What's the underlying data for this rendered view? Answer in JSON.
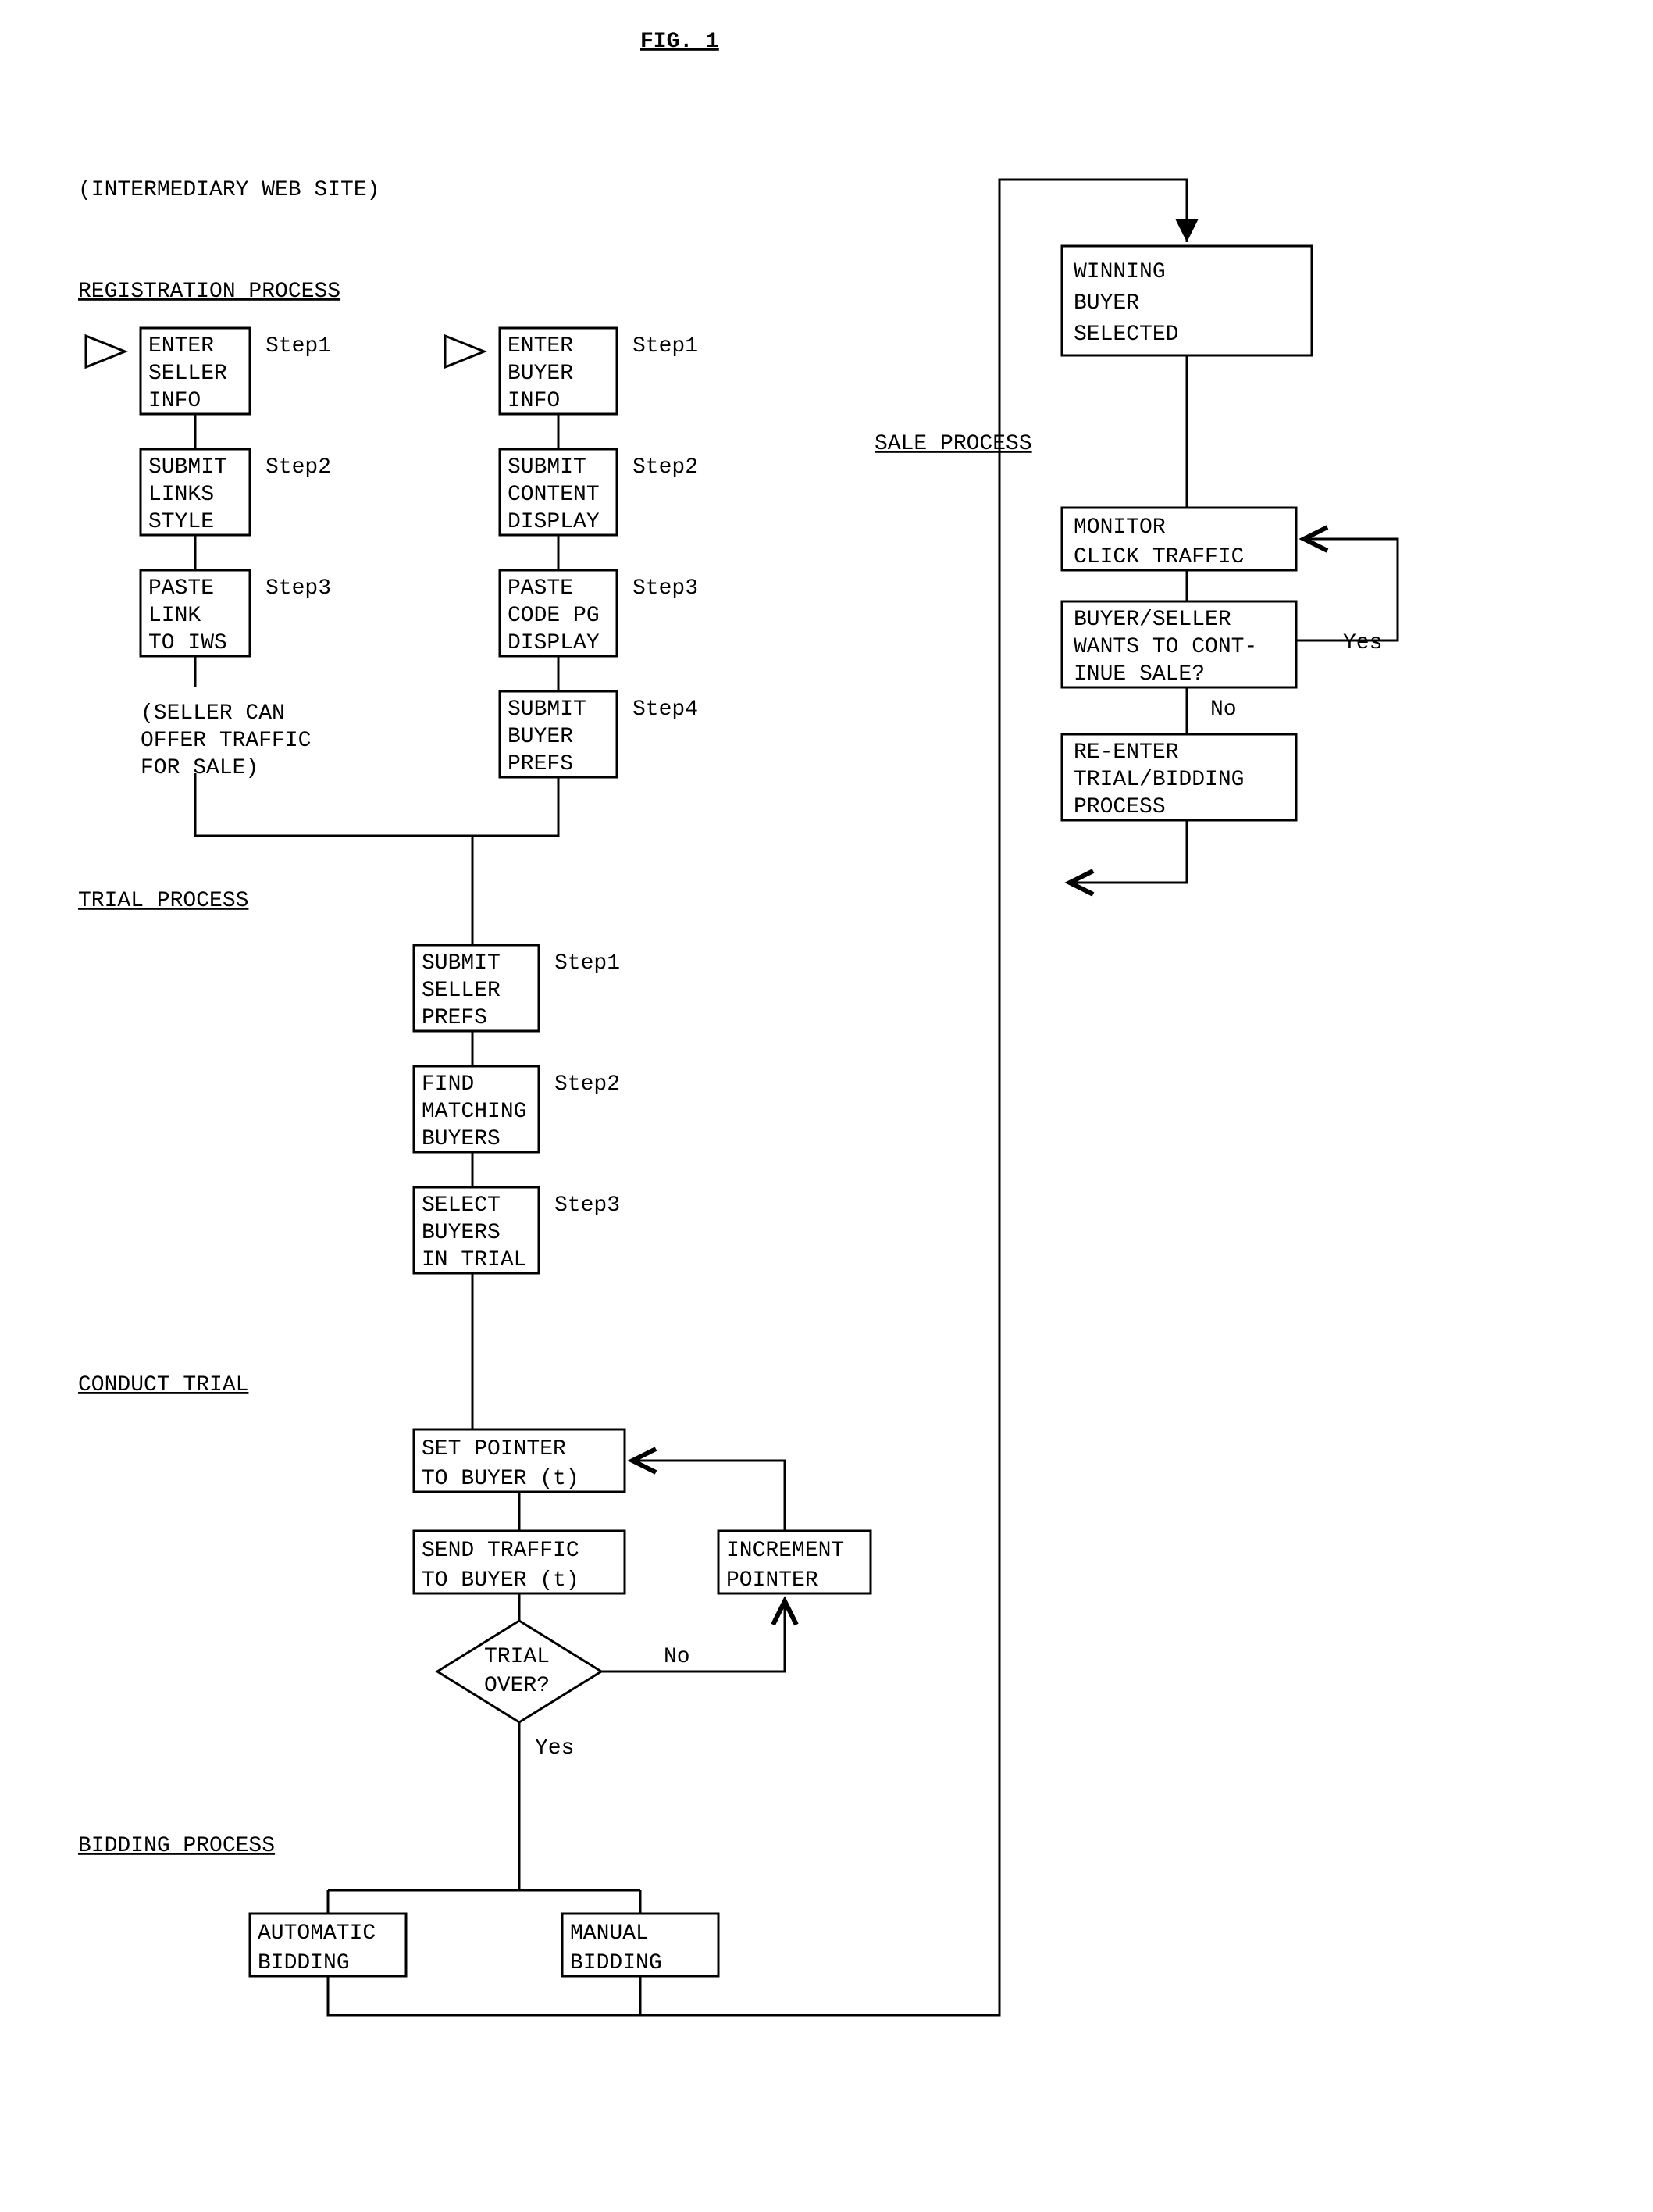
{
  "fig_title": "FIG. 1",
  "site_label": "(INTERMEDIARY WEB SITE)",
  "headers": {
    "registration": "REGISTRATION PROCESS",
    "trial": "TRIAL PROCESS",
    "conduct_trial": "CONDUCT TRIAL",
    "bidding": "BIDDING PROCESS",
    "sale": "SALE PROCESS"
  },
  "step_labels": {
    "s1": "Step1",
    "s2": "Step2",
    "s3": "Step3",
    "s4": "Step4"
  },
  "seller": {
    "b1": {
      "l1": "ENTER",
      "l2": "SELLER",
      "l3": "INFO"
    },
    "b2": {
      "l1": "SUBMIT",
      "l2": "LINKS",
      "l3": "STYLE"
    },
    "b3": {
      "l1": "PASTE",
      "l2": "LINK",
      "l3": "TO IWS"
    },
    "note": {
      "l1": "(SELLER CAN",
      "l2": "OFFER TRAFFIC",
      "l3": "FOR SALE)"
    }
  },
  "buyer": {
    "b1": {
      "l1": "ENTER",
      "l2": "BUYER",
      "l3": "INFO"
    },
    "b2": {
      "l1": "SUBMIT",
      "l2": "CONTENT",
      "l3": "DISPLAY"
    },
    "b3": {
      "l1": "PASTE",
      "l2": "CODE PG",
      "l3": "DISPLAY"
    },
    "b4": {
      "l1": "SUBMIT",
      "l2": "BUYER",
      "l3": "PREFS"
    }
  },
  "trial": {
    "b1": {
      "l1": "SUBMIT",
      "l2": "SELLER",
      "l3": "PREFS"
    },
    "b2": {
      "l1": "FIND",
      "l2": "MATCHING",
      "l3": "BUYERS"
    },
    "b3": {
      "l1": "SELECT",
      "l2": "BUYERS",
      "l3": "IN TRIAL"
    }
  },
  "conduct": {
    "set": {
      "l1": "SET POINTER",
      "l2": "TO BUYER (t)"
    },
    "send": {
      "l1": "SEND TRAFFIC",
      "l2": "TO BUYER (t)"
    },
    "dec": {
      "l1": "TRIAL",
      "l2": "OVER?"
    },
    "inc": {
      "l1": "INCREMENT",
      "l2": "POINTER"
    }
  },
  "bidding": {
    "auto": {
      "l1": "AUTOMATIC",
      "l2": "BIDDING"
    },
    "man": {
      "l1": "MANUAL",
      "l2": "BIDDING"
    }
  },
  "sale": {
    "win": {
      "l1": "WINNING",
      "l2": "BUYER",
      "l3": "SELECTED"
    },
    "mon": {
      "l1": "MONITOR",
      "l2": "CLICK TRAFFIC"
    },
    "cont": {
      "l1": "BUYER/SELLER",
      "l2": "WANTS TO CONT-",
      "l3": "INUE SALE?"
    },
    "re": {
      "l1": "RE-ENTER",
      "l2": "TRIAL/BIDDING",
      "l3": "PROCESS"
    }
  },
  "yn": {
    "yes": "Yes",
    "no": "No"
  }
}
